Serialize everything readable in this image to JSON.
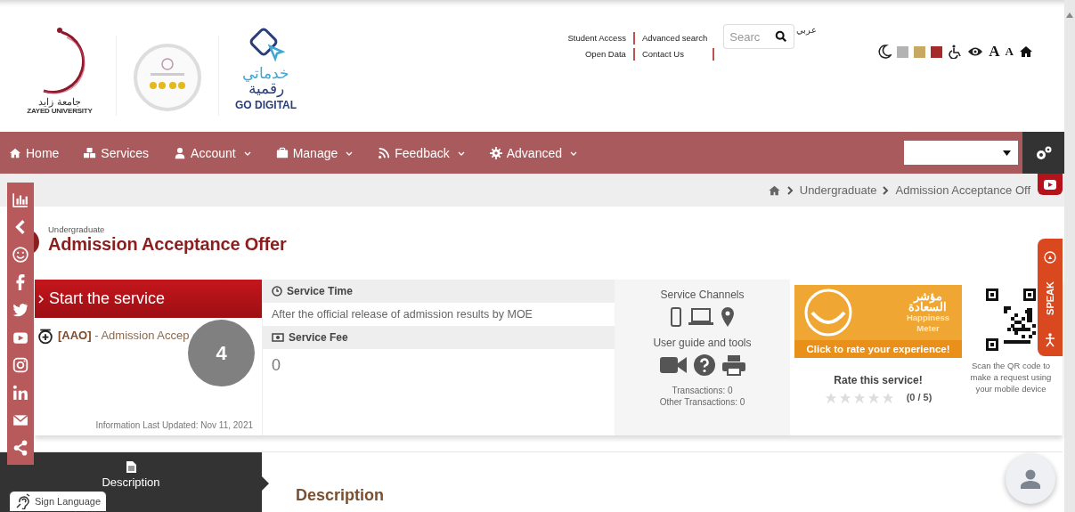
{
  "logos": {
    "university_arabic": "جامعة زايد",
    "university": "ZAYED UNIVERSITY",
    "digital_arabic_1": "خدماتي",
    "digital_arabic_2": "رقمية",
    "digital": "GO DIGITAL"
  },
  "top_links": [
    {
      "label": "Student Access"
    },
    {
      "label": "Advanced search"
    },
    {
      "label": "Open Data"
    },
    {
      "label": "Contact Us"
    }
  ],
  "search": {
    "placeholder": "Searc"
  },
  "language": "عربي",
  "color_themes": [
    {
      "color": "#b3b3b3"
    },
    {
      "color": "#c9a961"
    },
    {
      "color": "#a52a2a"
    }
  ],
  "font_buttons": [
    "A",
    "A"
  ],
  "nav": [
    {
      "label": "Home",
      "dropdown": false
    },
    {
      "label": "Services",
      "dropdown": false
    },
    {
      "label": "Account",
      "dropdown": true
    },
    {
      "label": "Manage",
      "dropdown": true
    },
    {
      "label": "Feedback",
      "dropdown": true
    },
    {
      "label": "Advanced",
      "dropdown": true
    }
  ],
  "breadcrumb": [
    "Undergraduate",
    "Admission Acceptance Off"
  ],
  "title": {
    "category": "Undergraduate",
    "name": "Admission Acceptance Offer"
  },
  "start": {
    "label": "Start the service",
    "code": "[AAO]",
    "name": "- Admission Accep",
    "updated": "Information Last Updated: Nov 11, 2021"
  },
  "badge": "4",
  "service_time": {
    "heading": "Service Time",
    "value": "After the official release of admission results by MOE"
  },
  "service_fee": {
    "heading": "Service Fee",
    "value": "0"
  },
  "channels": {
    "heading": "Service Channels",
    "tools_heading": "User guide and tools",
    "transactions": "Transactions: 0",
    "other_transactions": "Other Transactions: 0"
  },
  "happiness": {
    "arabic_1": "مؤشر",
    "arabic_2": "السعادة",
    "line_1": "Happiness",
    "line_2": "Meter",
    "cta": "Click to rate your experience!"
  },
  "rating": {
    "heading": "Rate this service!",
    "stars": 0,
    "count": "(0 / 5)"
  },
  "qr": {
    "caption": "Scan the QR code to make a request using your mobile device"
  },
  "speak": "SPEAK",
  "tabs": [
    {
      "label": "Description",
      "selected": true
    }
  ],
  "section_heading": "Description",
  "sign_language": "Sign Language"
}
